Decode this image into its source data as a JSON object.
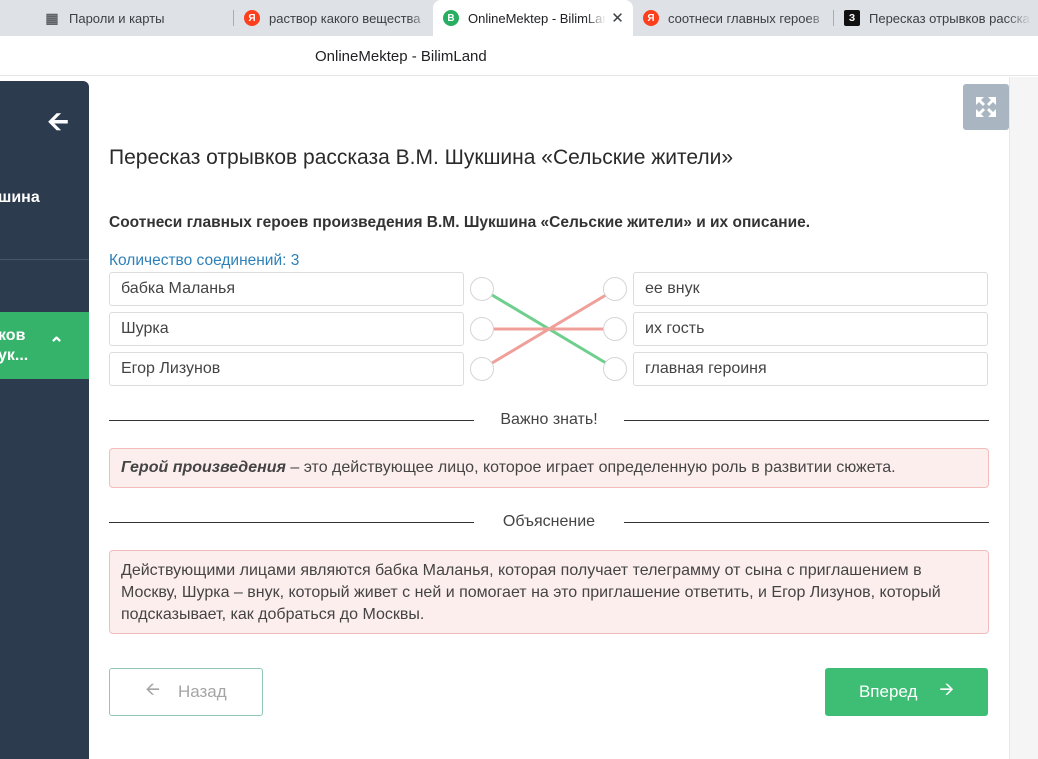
{
  "browser": {
    "tabs": [
      {
        "icon": "password-manager-icon",
        "title": "Пароли и карты",
        "active": false
      },
      {
        "icon": "yandex-icon",
        "title": "раствор какого вещества",
        "active": false
      },
      {
        "icon": "bilimland-icon",
        "title": "OnlineMektep - BilimLand",
        "active": true
      },
      {
        "icon": "yandex-icon",
        "title": "соотнеси главных героев",
        "active": false
      },
      {
        "icon": "znanija-icon",
        "title": "Пересказ отрывков расска",
        "active": false
      }
    ],
    "page_title": "OnlineMektep - BilimLand"
  },
  "sidebar": {
    "item1_text": "шина",
    "item1_arrow": "›",
    "active_line1": "ков",
    "active_line2": "ук..."
  },
  "lesson": {
    "title": "Пересказ отрывков рассказа В.М. Шукшина «Сельские жители»",
    "question": "Соотнеси главных героев произведения В.М. Шукшина «Сельские жители» и их описание.",
    "connections_label": "Количество соединений: 3"
  },
  "match": {
    "left": [
      "бабка Маланья",
      "Шурка",
      "Егор Лизунов"
    ],
    "right": [
      "ее внук",
      "их гость",
      "главная героиня"
    ],
    "links": [
      {
        "from": 0,
        "to": 2,
        "color": "#6fcf8e"
      },
      {
        "from": 1,
        "to": 1,
        "color": "#f0a09a"
      },
      {
        "from": 2,
        "to": 0,
        "color": "#f0a09a"
      }
    ]
  },
  "important": {
    "label": "Важно знать!",
    "term": "Герой произведения",
    "text": " – это действующее лицо, которое играет определенную роль в развитии сюжета."
  },
  "explanation": {
    "label": "Объяснение",
    "text": "Действующими лицами являются бабка Маланья, которая получает телеграмму от сына с приглашением в Москву, Шурка – внук, который живет с ней и помогает на это приглашение ответить, и Егор Лизунов, который подсказывает, как добраться до Москвы."
  },
  "nav": {
    "back_label": "Назад",
    "next_label": "Вперед"
  },
  "colors": {
    "sidebar_bg": "#2d3b4e",
    "accent_green": "#3ebe74",
    "note_bg": "#fdeeee",
    "link_blue": "#2e80b8"
  }
}
